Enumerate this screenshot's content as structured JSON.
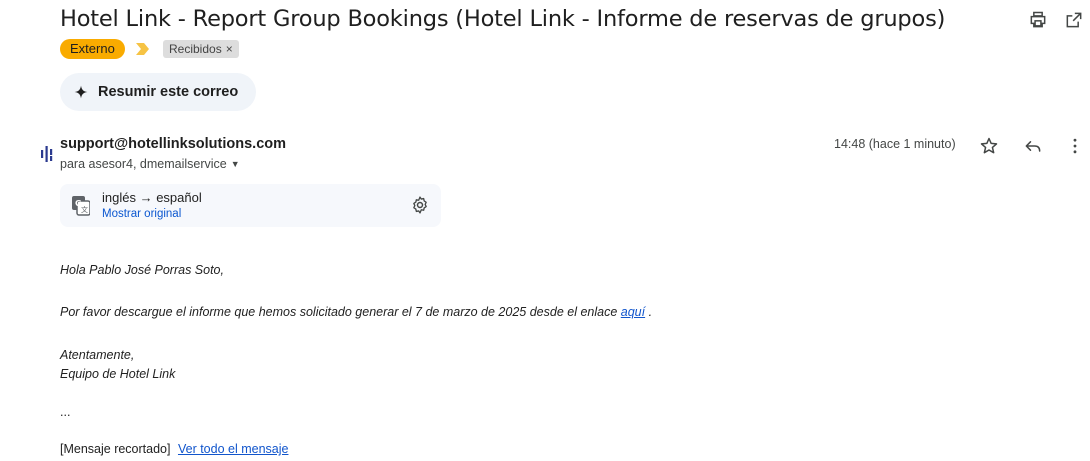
{
  "email": {
    "subject": "Hotel Link - Report Group Bookings (Hotel Link - Informe de reservas de grupos)",
    "labels": {
      "external": "Externo",
      "inbox": "Recibidos",
      "inbox_remove": "×"
    },
    "summarize_label": "Resumir este correo",
    "sender": "support@hotellinksolutions.com",
    "recipients": "para asesor4, dmemailservice",
    "time": "14:48 (hace 1 minuto)",
    "translation": {
      "languages": "inglés → español",
      "show_original": "Mostrar original"
    },
    "body": {
      "greeting": "Hola Pablo José Porras Soto,",
      "line1_before": "Por favor descargue el informe que hemos solicitado generar el 7 de marzo de 2025 desde el enlace",
      "line1_link": "aquí",
      "line1_after": ".",
      "signoff": "Atentamente,",
      "team": "Equipo de Hotel Link",
      "ellipsis": "...",
      "clipped": "[Mensaje recortado]",
      "view_all": "Ver todo el mensaje"
    }
  },
  "icons": {
    "print": "print-icon",
    "open_new": "open-in-new-window-icon",
    "sparkle": "sparkle-icon",
    "star": "star-icon",
    "reply": "reply-icon",
    "more": "more-vertical-icon",
    "translate": "translate-icon",
    "settings": "settings-gear-icon",
    "caret": "caret-down-icon",
    "sender_logo": "sender-logo-icon",
    "important": "important-marker-icon"
  },
  "colors": {
    "external_tag": "#f9ab00",
    "inbox_tag": "#dddddd",
    "summarize_bg": "#f0f4f9",
    "link": "#0b57d0",
    "important": "#f6c344"
  }
}
